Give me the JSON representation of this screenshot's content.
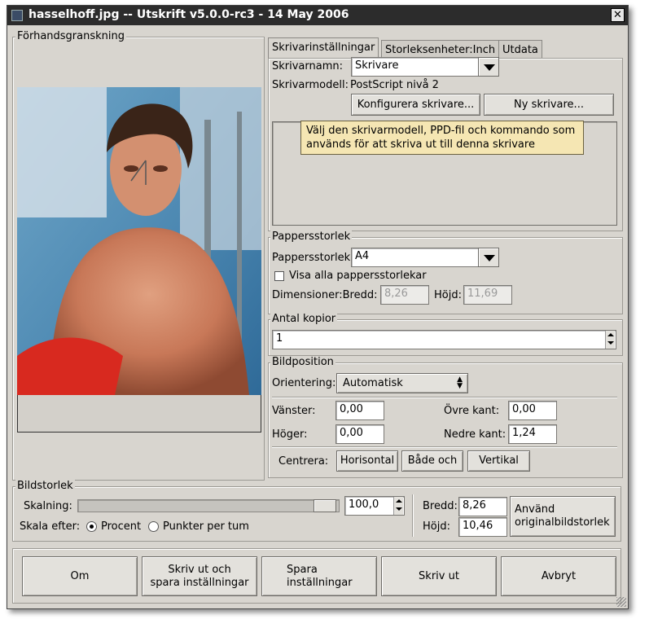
{
  "window": {
    "title": "hasselhoff.jpg -- Utskrift v5.0.0-rc3 - 14 May 2006",
    "close_glyph": "✕"
  },
  "preview": {
    "legend": "Förhandsgranskning"
  },
  "tabs": [
    {
      "label": "Skrivarinställningar",
      "active": true
    },
    {
      "label": "Storleksenheter:Inch",
      "active": false
    },
    {
      "label": "Utdata",
      "active": false
    }
  ],
  "printer": {
    "name_label": "Skrivarnamn:",
    "name_value": "Skrivare",
    "model_label": "Skrivarmodell:",
    "model_value": "PostScript nivå 2",
    "configure_button": "Konfigurera skrivare...",
    "new_button": "Ny skrivare...",
    "tooltip_line1": "Välj den skrivarmodell, PPD-fil och kommando som",
    "tooltip_line2": "används för att skriva ut till denna skrivare"
  },
  "paper": {
    "legend": "Pappersstorlek",
    "size_label": "Pappersstorlek",
    "size_value": "A4",
    "show_all_label": "Visa alla pappersstorlekar",
    "show_all_checked": false,
    "dims_label": "Dimensioner:Bredd:",
    "width_value": "8,26",
    "height_label": "Höjd:",
    "height_value": "11,69"
  },
  "copies": {
    "legend": "Antal kopior",
    "value": "1"
  },
  "position": {
    "legend": "Bildposition",
    "orientation_label": "Orientering:",
    "orientation_value": "Automatisk",
    "left_label": "Vänster:",
    "left_value": "0,00",
    "top_label": "Övre kant:",
    "top_value": "0,00",
    "right_label": "Höger:",
    "right_value": "0,00",
    "bottom_label": "Nedre kant:",
    "bottom_value": "1,24",
    "center_label": "Centrera:",
    "center_horizontal": "Horisontal",
    "center_both": "Både och",
    "center_vertical": "Vertikal"
  },
  "imagesize": {
    "legend": "Bildstorlek",
    "scale_label": "Skalning:",
    "scale_value": "100,0",
    "scale_by_label": "Skala efter:",
    "opt_percent": "Procent",
    "opt_ppi": "Punkter per tum",
    "selected": "Procent",
    "width_label": "Bredd:",
    "width_value": "8,26",
    "height_label": "Höjd:",
    "height_value": "10,46",
    "use_original_line1": "Använd",
    "use_original_line2": "originalbildstorlek"
  },
  "footer": {
    "about": "Om",
    "print_save_line1": "Skriv ut och",
    "print_save_line2": "spara inställningar",
    "save_line1": "Spara",
    "save_line2": "inställningar",
    "print": "Skriv ut",
    "cancel": "Avbryt"
  }
}
